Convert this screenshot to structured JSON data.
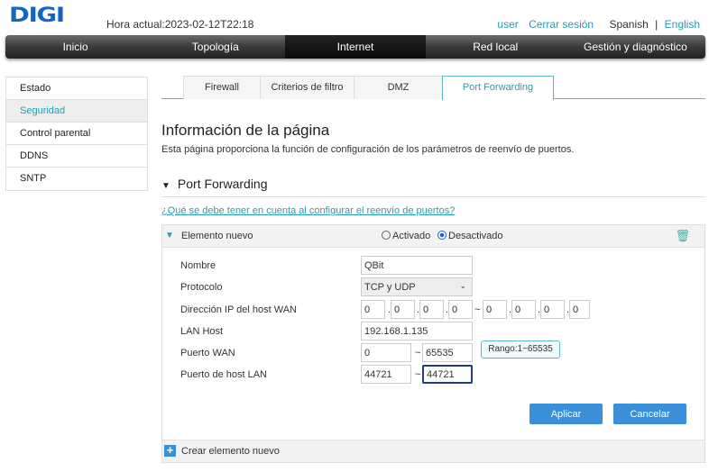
{
  "header": {
    "logo": "DIGI",
    "time": "Hora actual:2023-02-12T22:18",
    "user": "user",
    "logout": "Cerrar sesión",
    "lang_es": "Spanish",
    "sep": "|",
    "lang_en": "English"
  },
  "nav": [
    "Inicio",
    "Topología",
    "Internet",
    "Red local",
    "Gestión y diagnóstico"
  ],
  "nav_active": "Internet",
  "sidebar": [
    "Estado",
    "Seguridad",
    "Control parental",
    "DDNS",
    "SNTP"
  ],
  "sidebar_active": "Seguridad",
  "tabs": [
    "Firewall",
    "Criterios de filtro",
    "DMZ",
    "Port Forwarding"
  ],
  "tab_active": "Port Forwarding",
  "page": {
    "title": "Información de la página",
    "desc": "Esta página proporciona la función de configuración de los parámetros de reenvío de puertos.",
    "section": "Port Forwarding",
    "help_link": "¿Qué se debe tener en cuenta al configurar el reenvío de puertos?"
  },
  "entry": {
    "title": "Elemento nuevo",
    "opt_on": "Activado",
    "opt_off": "Desactivado",
    "selected": "Desactivado",
    "labels": [
      "Nombre",
      "Protocolo",
      "Dirección IP del host WAN",
      "LAN Host",
      "Puerto WAN",
      "Puerto de host LAN"
    ],
    "name": "QBit",
    "protocol": "TCP y UDP",
    "wan_ip_start": [
      "0",
      "0",
      "0",
      "0"
    ],
    "wan_ip_end": [
      "0",
      "0",
      "0",
      "0"
    ],
    "lan_host": "192.168.1.135",
    "wan_port_start": "0",
    "wan_port_end": "65535",
    "lan_port_start": "44721",
    "lan_port_end": "44721",
    "tilde": "~",
    "tooltip": "Rango:1~65535",
    "apply": "Aplicar",
    "cancel": "Cancelar"
  },
  "create_new": "Crear elemento nuevo",
  "colors": {
    "accent": "#2a9bb0",
    "button": "#3b8fd8"
  }
}
